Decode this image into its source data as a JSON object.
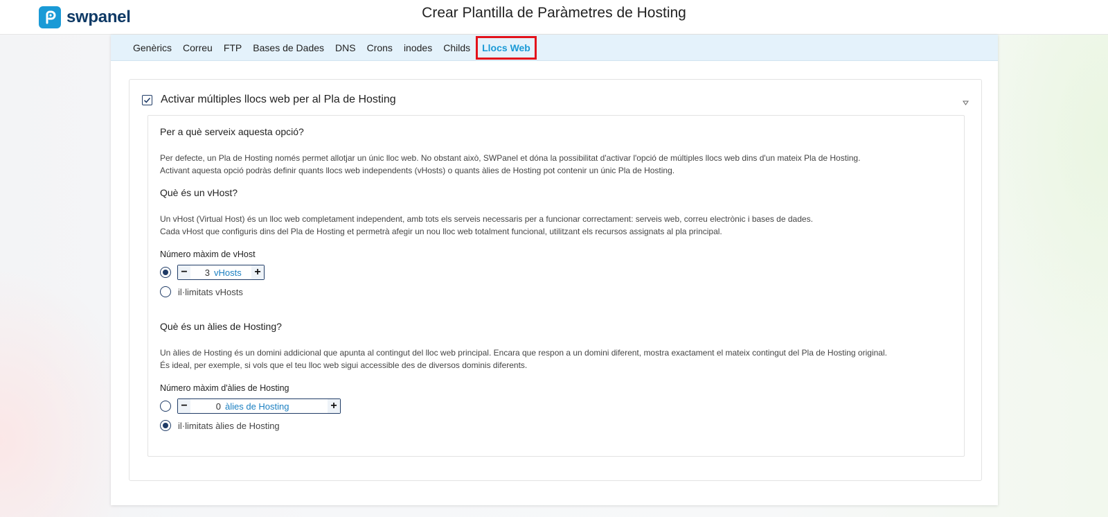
{
  "brand": {
    "name": "swpanel",
    "color": "#1a9ad6"
  },
  "page_title": "Crear Plantilla de Paràmetres de Hosting",
  "tabs": [
    {
      "label": "Genèrics",
      "active": false
    },
    {
      "label": "Correu",
      "active": false
    },
    {
      "label": "FTP",
      "active": false
    },
    {
      "label": "Bases de Dades",
      "active": false
    },
    {
      "label": "DNS",
      "active": false
    },
    {
      "label": "Crons",
      "active": false
    },
    {
      "label": "inodes",
      "active": false
    },
    {
      "label": "Childs",
      "active": false
    },
    {
      "label": "Llocs Web",
      "active": true
    }
  ],
  "card": {
    "checked": true,
    "title": "Activar múltiples llocs web per al Pla de Hosting",
    "sections": {
      "purpose": {
        "title": "Per a què serveix aquesta opció?",
        "line1": "Per defecte, un Pla de Hosting només permet allotjar un únic lloc web. No obstant això, SWPanel et dóna la possibilitat d'activar l'opció de múltiples llocs web dins d'un mateix Pla de Hosting.",
        "line2": "Activant aquesta opció podràs definir quants llocs web independents (vHosts) o quants àlies de Hosting pot contenir un únic Pla de Hosting."
      },
      "vhost": {
        "title": "Què és un vHost?",
        "line1": "Un vHost (Virtual Host) és un lloc web completament independent, amb tots els serveis necessaris per a funcionar correctament: serveis web, correu electrònic i bases de dades.",
        "line2": "Cada vHost que configuris dins del Pla de Hosting et permetrà afegir un nou lloc web totalment funcional, utilitzant els recursos assignats al pla principal.",
        "field_label": "Número màxim de vHost",
        "limited_selected": true,
        "value": "3",
        "unit": "vHosts",
        "unlimited_label": "il·limitats vHosts"
      },
      "alias": {
        "title": "Què és un àlies de Hosting?",
        "line1": "Un àlies de Hosting és un domini addicional que apunta al contingut del lloc web principal. Encara que respon a un domini diferent, mostra exactament el mateix contingut del Pla de Hosting original.",
        "line2": "És ideal, per exemple, si vols que el teu lloc web sigui accessible des de diversos dominis diferents.",
        "field_label": "Número màxim d'àlies de Hosting",
        "limited_selected": false,
        "value": "0",
        "unit": "àlies de Hosting",
        "unlimited_label": "il·limitats àlies de Hosting"
      }
    }
  },
  "icons": {
    "logo": "swpanel-logo-icon",
    "check": "checkmark-icon",
    "collapse": "triangle-down-icon",
    "minus": "minus-icon",
    "plus": "plus-icon"
  }
}
